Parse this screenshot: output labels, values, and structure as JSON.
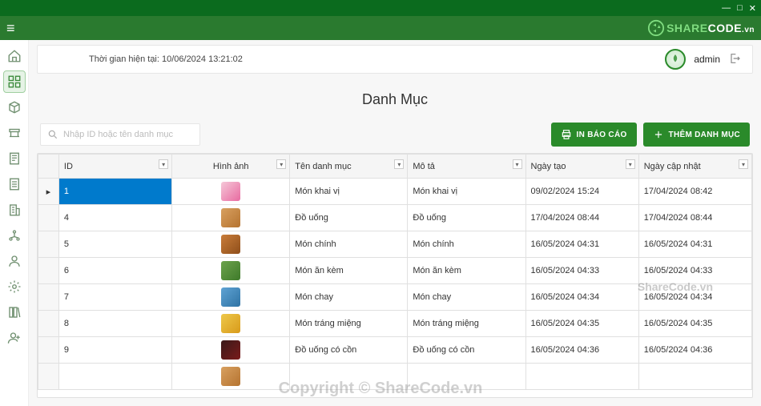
{
  "window": {
    "minimize": "—",
    "maximize": "□",
    "close": "✕"
  },
  "brand": {
    "share": "SHARE",
    "code": "CODE",
    "vn": ".vn"
  },
  "header": {
    "time_label": "Thời gian hiện tại: 10/06/2024 13:21:02",
    "username": "admin"
  },
  "page": {
    "title": "Danh Mục"
  },
  "search": {
    "placeholder": "Nhập ID hoặc tên danh mục"
  },
  "buttons": {
    "print_report": "IN BÁO CÁO",
    "add_category": "THÊM DANH MỤC"
  },
  "table": {
    "columns": {
      "id": "ID",
      "image": "Hình ảnh",
      "name": "Tên danh mục",
      "desc": "Mô tả",
      "created": "Ngày tạo",
      "updated": "Ngày cập nhật"
    },
    "rows": [
      {
        "id": "1",
        "name": "Món khai vị",
        "desc": "Món khai vị",
        "created": "09/02/2024 15:24",
        "updated": "17/04/2024 08:42",
        "thumb_colors": [
          "#f5c8d8",
          "#e86aa0"
        ],
        "selected": true
      },
      {
        "id": "4",
        "name": "Đồ uống",
        "desc": "Đồ uống",
        "created": "17/04/2024 08:44",
        "updated": "17/04/2024 08:44",
        "thumb_colors": [
          "#d8a060",
          "#b57330"
        ]
      },
      {
        "id": "5",
        "name": "Món chính",
        "desc": "Món chính",
        "created": "16/05/2024 04:31",
        "updated": "16/05/2024 04:31",
        "thumb_colors": [
          "#c97d3a",
          "#8f4e1a"
        ]
      },
      {
        "id": "6",
        "name": "Món ăn kèm",
        "desc": "Món ăn kèm",
        "created": "16/05/2024 04:33",
        "updated": "16/05/2024 04:33",
        "thumb_colors": [
          "#6da34d",
          "#3e7a2a"
        ]
      },
      {
        "id": "7",
        "name": "Món chay",
        "desc": "Món chay",
        "created": "16/05/2024 04:34",
        "updated": "16/05/2024 04:34",
        "thumb_colors": [
          "#5fa3d4",
          "#2f73a4"
        ]
      },
      {
        "id": "8",
        "name": "Món tráng miệng",
        "desc": "Món tráng miệng",
        "created": "16/05/2024 04:35",
        "updated": "16/05/2024 04:35",
        "thumb_colors": [
          "#eec84a",
          "#d89a1a"
        ]
      },
      {
        "id": "9",
        "name": "Đồ uống có cồn",
        "desc": "Đồ uống có cồn",
        "created": "16/05/2024 04:36",
        "updated": "16/05/2024 04:36",
        "thumb_colors": [
          "#3a1a1a",
          "#7a1a1a"
        ]
      }
    ]
  },
  "watermark": {
    "big": "Copyright © ShareCode.vn",
    "small": "ShareCode.vn"
  }
}
